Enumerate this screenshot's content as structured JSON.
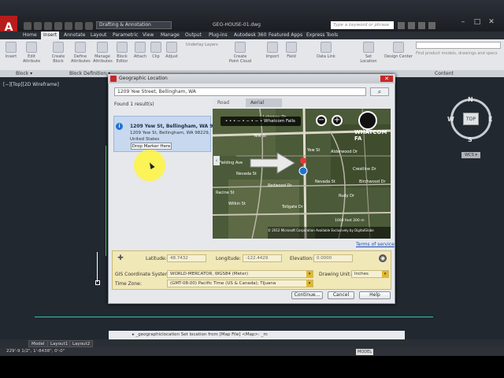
{
  "window": {
    "workspace": "Drafting & Annotation",
    "doc_title": "GEO-HOUSE-01.dwg",
    "search_placeholder": "Type a keyword or phrase",
    "min": "–",
    "max": "□",
    "close": "✕",
    "app_logo": "A"
  },
  "ribbon": {
    "tabs": [
      "Home",
      "Insert",
      "Annotate",
      "Layout",
      "Parametric",
      "View",
      "Manage",
      "Output",
      "Plug-ins",
      "Autodesk 360",
      "Featured Apps",
      "Express Tools"
    ],
    "active_tab": "Insert",
    "buttons": [
      "Insert",
      "Edit Attribute",
      "Create Block",
      "Define Attributes",
      "Manage Attributes",
      "Block Editor",
      "Attach",
      "Clip",
      "Adjust",
      "Create Point Cloud",
      "Import",
      "Field",
      "Data Link",
      "Set Location",
      "Design Center"
    ],
    "underlay_layers": "Underlay Layers",
    "panels": {
      "block": "Block ▾",
      "block_definition": "Block Definition ▾",
      "content": "Content"
    },
    "product_search": "Find product models, drawings and specs"
  },
  "viewport": {
    "label": "[−][Top][2D Wireframe]",
    "viewcube": {
      "top": "TOP",
      "n": "N",
      "s": "S",
      "e": "E",
      "w": "W",
      "wcs": "WCS ▾"
    }
  },
  "dialog": {
    "title": "Geographic Location",
    "close": "✕",
    "address": "1209 Yew Street, Bellingham, WA",
    "search_icon": "⌕",
    "found": "Found 1 result(s)",
    "result": {
      "pin": "i",
      "title": "1209 Yew St, Bellingham, WA 98229",
      "line2": "1209 Yew St, Bellingham, WA 98229,",
      "line3": "United States",
      "drop_marker": "Drop Marker Here"
    },
    "map": {
      "tabs": [
        "Road",
        "Aerial"
      ],
      "selected_tab": "Aerial",
      "search_bar": "• • • − • − • − •  Whatcom Falls",
      "zoom_out": "−",
      "zoom_in": "+",
      "compass": "",
      "nav_arrow": "‹",
      "labels": [
        "Whatcom Falls",
        "WHATCOM FA",
        "Yew St",
        "Yew St",
        "Fielding Ave",
        "Alderwood Dr",
        "Nevada St",
        "Nevada St",
        "Rudy Dr",
        "Wilkin St",
        "Redwood Dr",
        "Crestline Dr",
        "Lakeway Dr",
        "Tollgate Dr",
        "Birchwood Dr",
        "Racine St"
      ],
      "scale": "1000 feet        200 m",
      "credits": "© 2012 Microsoft Corporation   Available Exclusively by DigitalGlobe",
      "terms": "Terms of service"
    },
    "coords": {
      "pick": "✚",
      "latitude_label": "Latitude:",
      "latitude": "48.7432",
      "longitude_label": "Longitude:",
      "longitude": "-122.4429",
      "elevation_label": "Elevation:",
      "elevation": "0.0000",
      "reset": "◉",
      "gis_label": "GIS Coordinate System:",
      "gis": "WORLD-MERCATOR, WGS84 (Meter)",
      "unit_label": "Drawing Unit:",
      "unit": "Inches",
      "tz_label": "Time Zone:",
      "tz": "(GMT-08:00) Pacific Time (US & Canada); Tijuana",
      "dd": "▾"
    },
    "buttons": {
      "continue": "Continue...",
      "cancel": "Cancel",
      "help": "Help"
    }
  },
  "command": {
    "line": "▸ _geographiclocation Set location from [Map File] <Map>: _m"
  },
  "layout_tabs": [
    "Model",
    "Layout1",
    "Layout2"
  ],
  "status": {
    "coords": "229'-9 1/2\", 1'-8438\", 0'-0\"",
    "model": "MODEL"
  },
  "colors": {
    "accent": "#c62828",
    "ribbon": "#e4e6ea",
    "drawing": "#212830",
    "coord_panel": "#f1e8b8",
    "result_bg": "#c7d8ef"
  }
}
